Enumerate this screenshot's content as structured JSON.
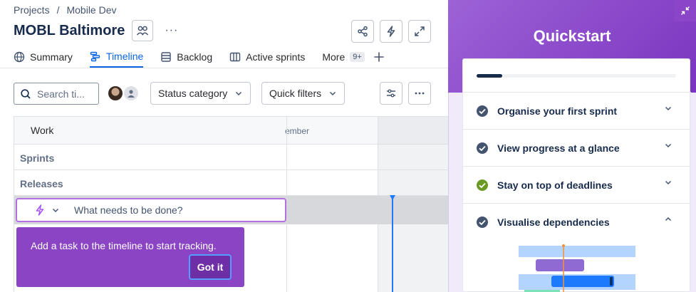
{
  "breadcrumb": {
    "projects": "Projects",
    "separator": "/",
    "current": "Mobile Dev"
  },
  "header": {
    "title": "MOBL Baltimore",
    "more": "···"
  },
  "tabs": [
    {
      "label": "Summary",
      "icon": "globe-icon"
    },
    {
      "label": "Timeline",
      "icon": "timeline-icon",
      "active": true
    },
    {
      "label": "Backlog",
      "icon": "backlog-icon"
    },
    {
      "label": "Active sprints",
      "icon": "board-icon"
    },
    {
      "label": "More",
      "badge": "9+"
    }
  ],
  "toolbar": {
    "search_placeholder": "Search ti...",
    "status_category": "Status category",
    "quick_filters": "Quick filters"
  },
  "timeline": {
    "work_header": "Work",
    "month_header": "ember",
    "rows": [
      "Sprints",
      "Releases"
    ],
    "new_item_placeholder": "What needs to be done?"
  },
  "tooltip": {
    "text": "Add a task to the timeline to start tracking.",
    "button": "Got it"
  },
  "quickstart": {
    "title": "Quickstart",
    "progress": 0.13,
    "items": [
      {
        "label": "Organise your first sprint",
        "status": "done",
        "expanded": false
      },
      {
        "label": "View progress at a glance",
        "status": "done",
        "expanded": false
      },
      {
        "label": "Stay on top of deadlines",
        "status": "done-green",
        "expanded": false
      },
      {
        "label": "Visualise dependencies",
        "status": "done",
        "expanded": true
      }
    ]
  },
  "colors": {
    "accent": "#0c66e4",
    "purple": "#8a44c4",
    "green": "#6a9a23"
  }
}
